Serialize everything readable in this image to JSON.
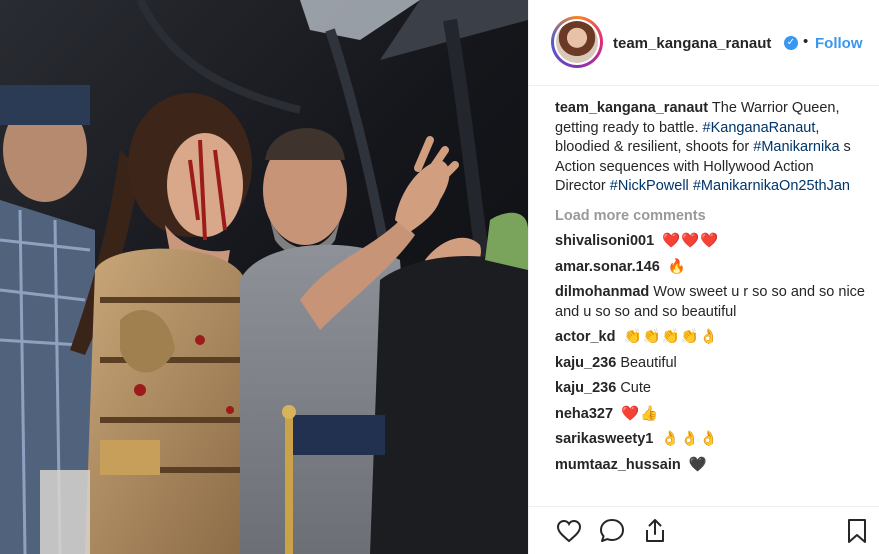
{
  "post": {
    "username": "team_kangana_ranaut",
    "follow_label": "Follow",
    "separator": "•",
    "verified_mark": "✓",
    "caption": {
      "username": "team_kangana_ranaut",
      "text_1": " The Warrior Queen, getting ready to battle. ",
      "tag_1": "#KanganaRanaut",
      "text_2": ", bloodied & resilient, shoots for ",
      "tag_2": "#Manikarnika",
      "text_3": " s Action sequences with Hollywood Action Director ",
      "tag_3": "#NickPowell",
      "text_4": " ",
      "tag_4": "#ManikarnikaOn25thJan"
    },
    "load_more": "Load more comments",
    "comments": [
      {
        "user": "shivalisoni001",
        "text": "❤️❤️❤️"
      },
      {
        "user": "amar.sonar.146",
        "text": "🔥"
      },
      {
        "user": "dilmohanmad",
        "text": "Wow sweet u r so so and so nice and u so so and so beautiful"
      },
      {
        "user": "actor_kd",
        "text": "👏👏👏👏👌"
      },
      {
        "user": "kaju_236",
        "text": "Beautiful"
      },
      {
        "user": "kaju_236",
        "text": "Cute"
      },
      {
        "user": "neha327",
        "text": "❤️👍"
      },
      {
        "user": "sarikasweety1",
        "text": "👌👌👌"
      },
      {
        "user": "mumtaaz_hussain",
        "text": "🖤"
      }
    ],
    "icons": {
      "like": "heart-icon",
      "comment": "comment-bubble-icon",
      "share": "share-icon",
      "save": "bookmark-icon"
    },
    "colors": {
      "link": "#3897f0",
      "hashtag": "#003569",
      "muted": "#999999",
      "text": "#262626"
    }
  }
}
